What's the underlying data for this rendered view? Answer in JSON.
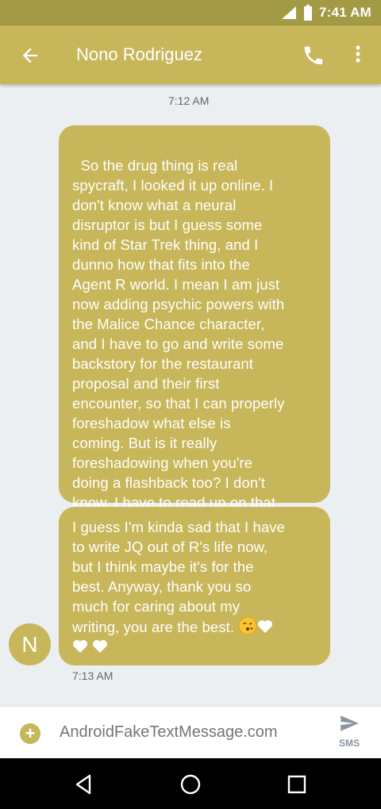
{
  "status_bar": {
    "time": "7:41 AM"
  },
  "header": {
    "contact_name": "Nono Rodriguez"
  },
  "messages": {
    "timestamp_top": "7:12 AM",
    "bubble1": "So the drug thing is real\nspycraft, I looked it up online. I\ndon't know what a neural\ndisruptor is but I guess some\nkind of Star Trek thing, and I\ndunno how that fits into the\nAgent R world. I mean I am just\nnow adding psychic powers with\nthe Malice Chance character,\nand I have to go and write some\nbackstory for the restaurant\nproposal and their first\nencounter, so that I can properly\nforeshadow what else is\ncoming. But is it really\nforeshadowing when you're\ndoing a flashback too? I don't\nknow, I have to read up on that.",
    "bubble2": "I guess I'm kinda sad that I have\nto write JQ out of R's life now,\nbut I think maybe it's for the\nbest. Anyway, thank you so\nmuch for caring about my\nwriting, you are the best.",
    "timestamp_bottom": "7:13 AM",
    "avatar_letter": "N"
  },
  "composer": {
    "placeholder": "AndroidFakeTextMessage.com",
    "send_label": "SMS"
  },
  "colors": {
    "accent": "#c8b65a",
    "status_bar": "#a39a46",
    "background": "#eceff1"
  }
}
